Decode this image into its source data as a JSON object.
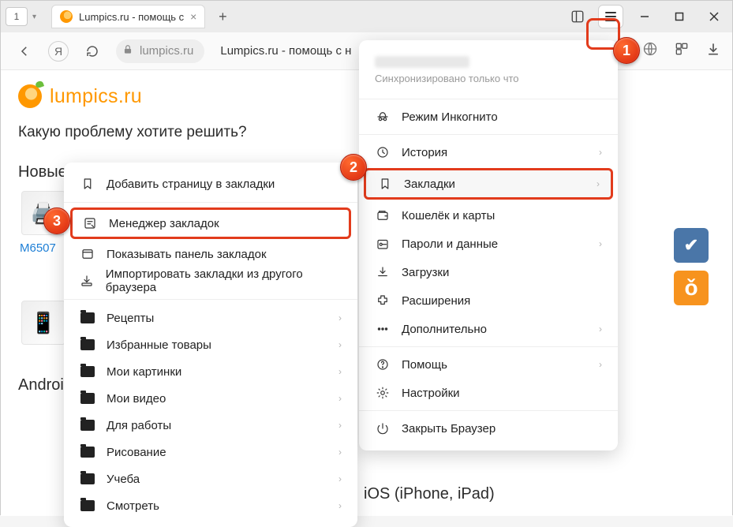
{
  "tab": {
    "title": "Lumpics.ru - помощь с",
    "count": "1"
  },
  "address": {
    "domain": "lumpics.ru",
    "pagetitle": "Lumpics.ru - помощь с н"
  },
  "page": {
    "logo": "lumpics.ru",
    "search_prompt": "Какую проблему хотите решить?",
    "section_new": "Новые с",
    "card_label": "M6507",
    "section_android": "Android",
    "section_ios": "iOS (iPhone, iPad)"
  },
  "menu": {
    "sync_status": "Синхронизировано только что",
    "incognito": "Режим Инкогнито",
    "history": "История",
    "bookmarks": "Закладки",
    "wallet": "Кошелёк и карты",
    "passwords": "Пароли и данные",
    "downloads": "Загрузки",
    "extensions": "Расширения",
    "more": "Дополнительно",
    "help": "Помощь",
    "settings": "Настройки",
    "close": "Закрыть Браузер"
  },
  "submenu": {
    "add": "Добавить страницу в закладки",
    "manager": "Менеджер закладок",
    "show_bar": "Показывать панель закладок",
    "import": "Импортировать закладки из другого браузера",
    "folders": [
      "Рецепты",
      "Избранные товары",
      "Мои картинки",
      "Мои видео",
      "Для работы",
      "Рисование",
      "Учеба",
      "Смотреть"
    ]
  },
  "badges": {
    "b1": "1",
    "b2": "2",
    "b3": "3"
  }
}
